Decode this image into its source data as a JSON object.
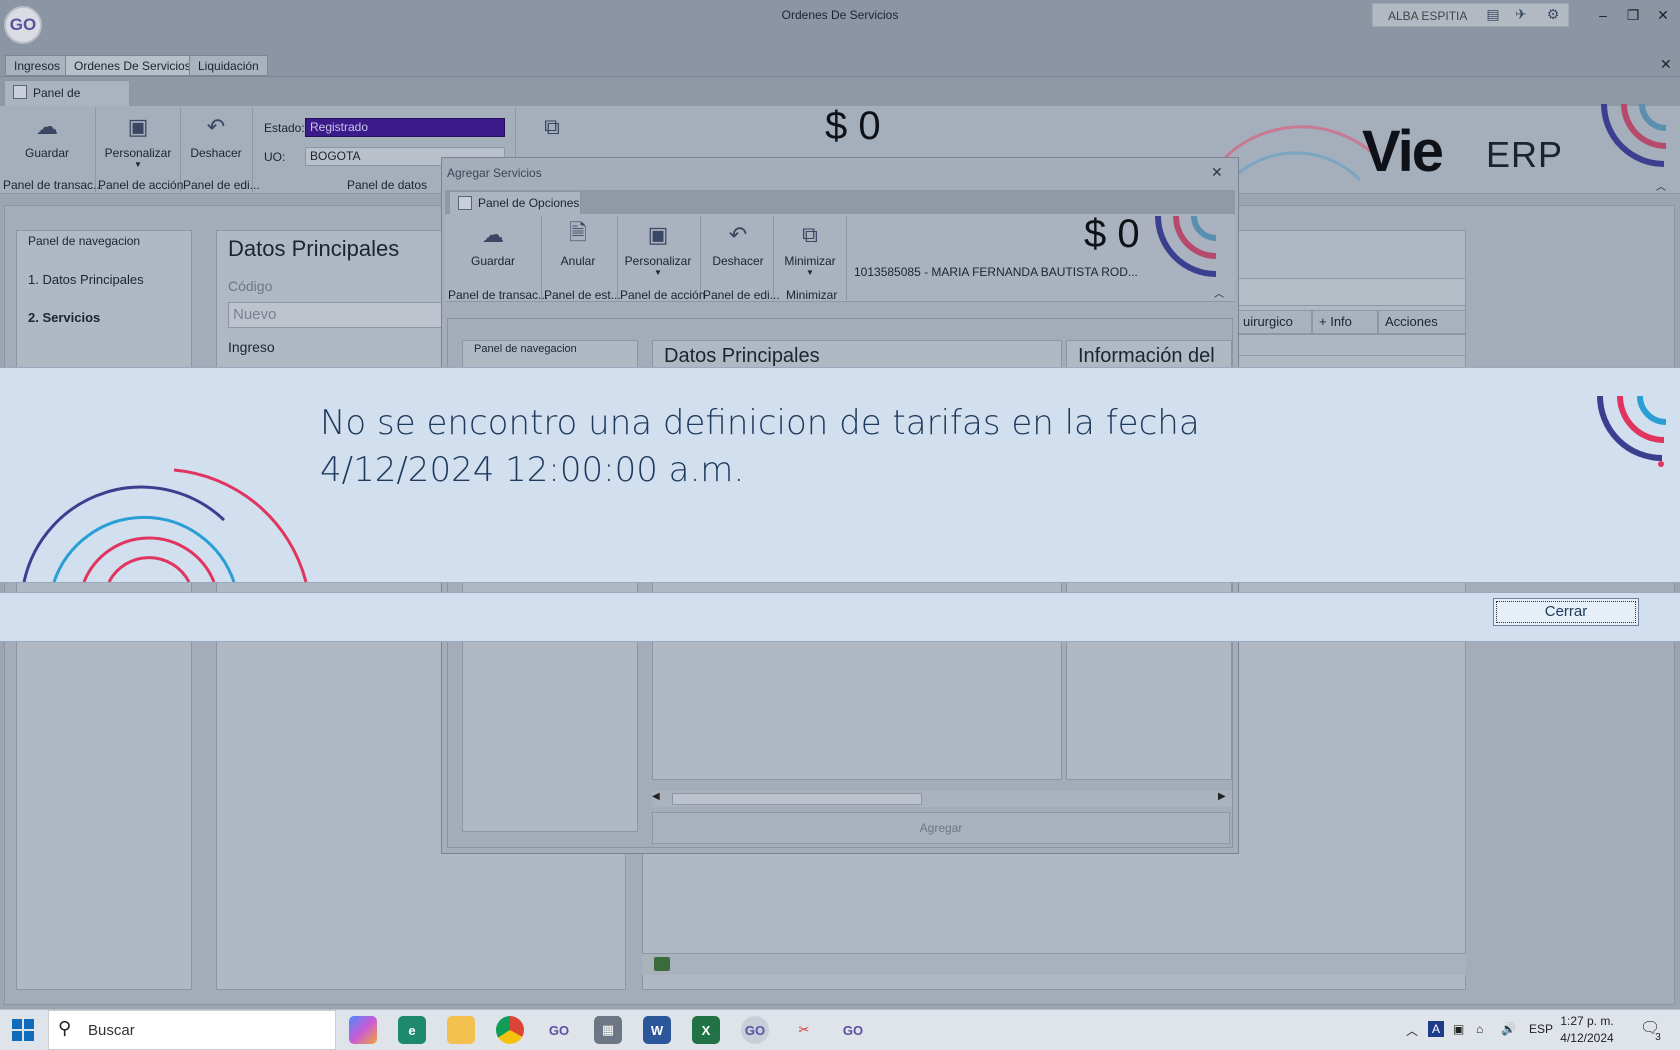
{
  "window": {
    "title": "Ordenes De Servicios",
    "user": "ALBA ESPITIA",
    "app_logo": "GO"
  },
  "doc_tabs": [
    "Ingresos",
    "Ordenes De Servicios",
    "Liquidación"
  ],
  "ribbon": {
    "tab": "Panel de Opciones",
    "buttons": {
      "guardar": "Guardar",
      "personalizar": "Personalizar",
      "deshacer": "Deshacer",
      "minimizar": "Minimizar"
    },
    "groups": {
      "transac": "Panel de transac...",
      "accion": "Panel de acción",
      "edicion": "Panel de edi...",
      "datos": "Panel de datos"
    },
    "estado_label": "Estado:",
    "estado_value": "Registrado",
    "uo_label": "UO:",
    "uo_value": "BOGOTA",
    "total": "$ 0",
    "brand": "Vie",
    "brand_suffix": "ERP"
  },
  "main": {
    "nav_title": "Panel de navegacion",
    "nav_items": [
      "1. Datos Principales",
      "2. Servicios"
    ],
    "section_title": "Datos Principales",
    "codigo_label": "Código",
    "codigo_placeholder": "Nuevo",
    "ingreso_label": "Ingreso",
    "grid_headers": [
      "uirurgico",
      "+ Info",
      "Acciones"
    ]
  },
  "dialog": {
    "title": "Agregar Servicios",
    "ribbon_tab": "Panel de Opciones",
    "buttons": {
      "guardar": "Guardar",
      "anular": "Anular",
      "personalizar": "Personalizar",
      "deshacer": "Deshacer",
      "minimizar": "Minimizar"
    },
    "groups": {
      "transac": "Panel de transac...",
      "estado": "Panel de est...",
      "accion": "Panel de acción",
      "edicion": "Panel de edi...",
      "minimizar": "Minimizar"
    },
    "total": "$ 0",
    "patient": "1013585085 - MARIA FERNANDA BAUTISTA ROD...",
    "nav_title": "Panel de navegacion",
    "section_title": "Datos Principales",
    "info_title": "Información del",
    "agregar": "Agregar"
  },
  "message": {
    "text": "No se encontro una definicion de tarifas en la fecha 4/12/2024 12:00:00 a.m.",
    "close": "Cerrar"
  },
  "taskbar": {
    "search": "Buscar",
    "lang": "ESP",
    "time": "1:27 p. m.",
    "date": "4/12/2024",
    "notifications": "3"
  },
  "colors": {
    "accent": "#3b1b8a",
    "message_bg": "#d1dfef",
    "brand_pink": "#e0355f",
    "brand_blue": "#2a9fd6",
    "brand_purple": "#3b3f8f"
  }
}
